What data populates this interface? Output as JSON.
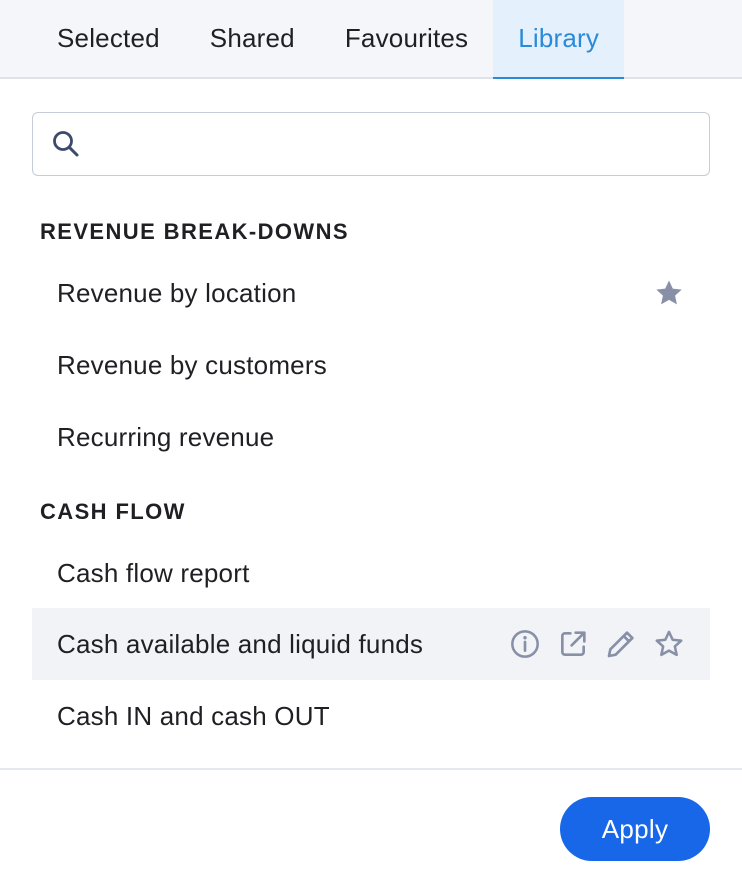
{
  "tabs": [
    {
      "label": "Selected",
      "active": false
    },
    {
      "label": "Shared",
      "active": false
    },
    {
      "label": "Favourites",
      "active": false
    },
    {
      "label": "Library",
      "active": true
    }
  ],
  "search": {
    "value": "",
    "placeholder": ""
  },
  "sections": [
    {
      "title": "REVENUE BREAK-DOWNS",
      "items": [
        {
          "label": "Revenue by location",
          "favourite": true
        },
        {
          "label": "Revenue by customers",
          "favourite": false
        },
        {
          "label": "Recurring revenue",
          "favourite": false
        }
      ]
    },
    {
      "title": "CASH FLOW",
      "items": [
        {
          "label": "Cash flow report",
          "favourite": false
        },
        {
          "label": "Cash available and liquid funds",
          "favourite": false,
          "hovered": true
        },
        {
          "label": "Cash IN and cash OUT",
          "favourite": false
        }
      ]
    }
  ],
  "footer": {
    "apply_label": "Apply"
  },
  "colors": {
    "accent": "#2a8ad9",
    "button": "#1767e8",
    "icon": "#8790a6",
    "hover_row": "#f1f3f7"
  }
}
